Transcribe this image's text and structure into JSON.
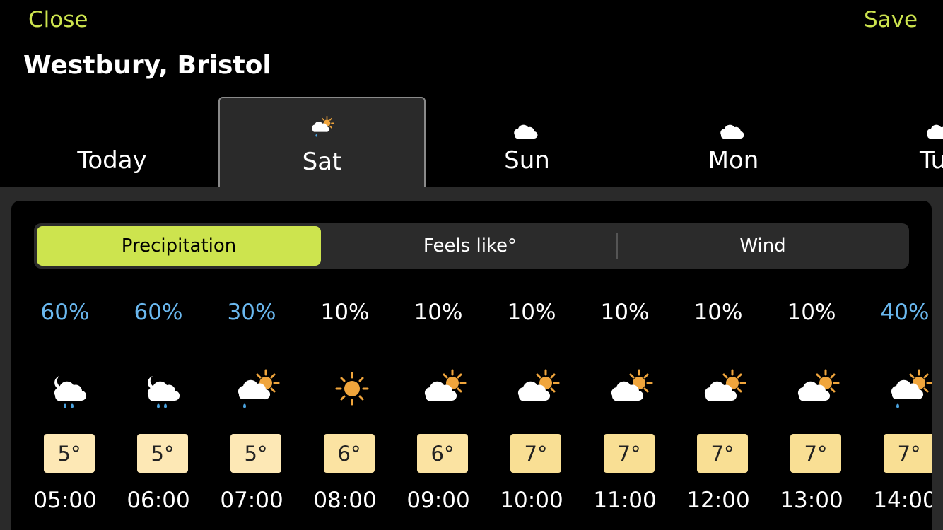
{
  "header": {
    "close_label": "Close",
    "save_label": "Save",
    "location": "Westbury, Bristol"
  },
  "days": [
    {
      "label": "Today",
      "icon": "none",
      "selected": false
    },
    {
      "label": "Sat",
      "icon": "sun-cloud-rain-icon",
      "selected": true
    },
    {
      "label": "Sun",
      "icon": "cloud-icon",
      "selected": false
    },
    {
      "label": "Mon",
      "icon": "cloud-icon",
      "selected": false
    },
    {
      "label": "Tu",
      "icon": "cloud-icon",
      "selected": false
    }
  ],
  "segments": {
    "precipitation": "Precipitation",
    "feels_like": "Feels like°",
    "wind": "Wind"
  },
  "hours": [
    {
      "pct": "60%",
      "temp": "5°",
      "time": "05:00",
      "icon": "moon-cloud-rain-icon"
    },
    {
      "pct": "60%",
      "temp": "5°",
      "time": "06:00",
      "icon": "moon-cloud-rain-icon"
    },
    {
      "pct": "30%",
      "temp": "5°",
      "time": "07:00",
      "icon": "sun-cloud-rain-icon"
    },
    {
      "pct": "10%",
      "temp": "6°",
      "time": "08:00",
      "icon": "sun-icon"
    },
    {
      "pct": "10%",
      "temp": "6°",
      "time": "09:00",
      "icon": "sun-cloud-icon"
    },
    {
      "pct": "10%",
      "temp": "7°",
      "time": "10:00",
      "icon": "sun-cloud-icon"
    },
    {
      "pct": "10%",
      "temp": "7°",
      "time": "11:00",
      "icon": "sun-cloud-icon"
    },
    {
      "pct": "10%",
      "temp": "7°",
      "time": "12:00",
      "icon": "sun-cloud-icon"
    },
    {
      "pct": "10%",
      "temp": "7°",
      "time": "13:00",
      "icon": "sun-cloud-icon"
    },
    {
      "pct": "40%",
      "temp": "7°",
      "time": "14:00",
      "icon": "sun-cloud-rain-icon"
    }
  ],
  "colors": {
    "accent": "#cde44e",
    "precip_high": "#6ab8ef",
    "precip_low": "#ffffff",
    "temp_5": "#fde8b5",
    "temp_6": "#fbe3a2",
    "temp_7": "#f9df94",
    "sun": "#f0a53c",
    "rain": "#4aa3e0"
  }
}
